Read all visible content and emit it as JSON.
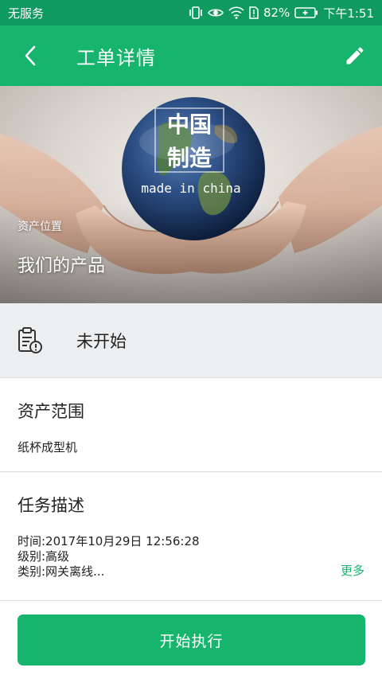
{
  "status_bar": {
    "carrier": "无服务",
    "battery_percent": "82%",
    "time": "下午1:51",
    "icons": [
      "vibrate-icon",
      "eye-icon",
      "wifi-icon",
      "sim-alert-icon",
      "battery-charging-icon"
    ]
  },
  "app_bar": {
    "title": "工单详情",
    "icons": [
      "back-arrow-icon",
      "edit-pencil-icon"
    ]
  },
  "hero": {
    "image_text_big": "中国制造",
    "image_text_small": "made in china",
    "asset_location_label": "资产位置",
    "asset_location_value": "我们的产品"
  },
  "status_row": {
    "icon": "clipboard-alert-icon",
    "status": "未开始"
  },
  "asset_scope": {
    "title": "资产范围",
    "value": "纸杯成型机"
  },
  "task_description": {
    "title": "任务描述",
    "line_time": "时间:2017年10月29日 12:56:28",
    "line_level": "级别:高级",
    "line_category": "类别:网关离线...",
    "more": "更多"
  },
  "actions": {
    "start_label": "开始执行"
  },
  "colors": {
    "primary": "#17b46d",
    "status_bar": "#0f9a60",
    "status_row_bg": "#eceef0",
    "more_link": "#17b46d"
  }
}
